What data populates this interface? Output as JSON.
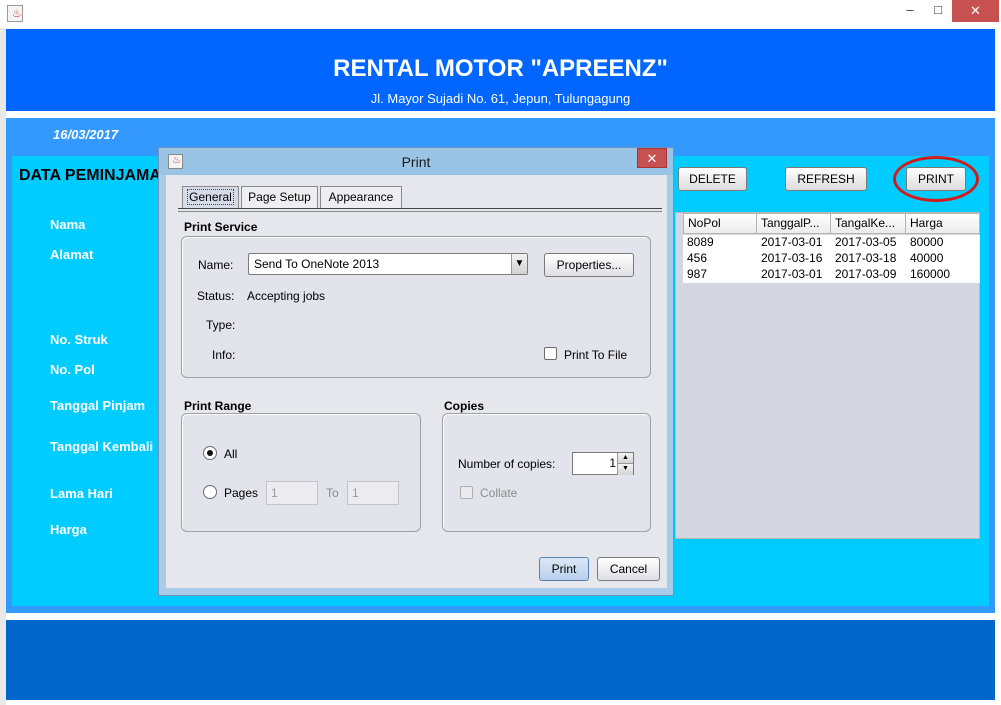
{
  "window": {
    "icon": "java-icon",
    "controls": {
      "minimize": "–",
      "maximize": "□",
      "close": "✕"
    }
  },
  "header": {
    "title": "RENTAL MOTOR \"APREENZ\"",
    "subtitle": "Jl. Mayor Sujadi No. 61, Jepun, Tulungagung"
  },
  "date": "16/03/2017",
  "section_title": "DATA PEMINJAMAN",
  "form_labels": {
    "nama": "Nama",
    "alamat": "Alamat",
    "no_struk": "No. Struk",
    "no_pol": "No. Pol",
    "tanggal_pinjam": "Tanggal Pinjam",
    "tanggal_kembali": "Tanggal Kembali",
    "lama_hari": "Lama Hari",
    "harga": "Harga"
  },
  "actions": {
    "delete": "DELETE",
    "refresh": "REFRESH",
    "print": "PRINT"
  },
  "table": {
    "columns": [
      "NoPol",
      "TanggalP...",
      "TangalKe...",
      "Harga"
    ],
    "rows": [
      [
        "8089",
        "2017-03-01",
        "2017-03-05",
        "80000"
      ],
      [
        "456",
        "2017-03-16",
        "2017-03-18",
        "40000"
      ],
      [
        "987",
        "2017-03-01",
        "2017-03-09",
        "160000"
      ]
    ]
  },
  "colors": {
    "header_blue": "#0066ff",
    "mid_blue": "#3399ff",
    "panel_cyan": "#00ccff",
    "footer_blue": "#0066cc",
    "highlight_red": "#d21b1b"
  },
  "dialog": {
    "title": "Print",
    "close_icon": "✕",
    "tabs": [
      "General",
      "Page Setup",
      "Appearance"
    ],
    "print_service": {
      "heading": "Print Service",
      "name_label": "Name:",
      "name_value": "Send To OneNote 2013",
      "properties_button": "Properties...",
      "status_label": "Status:",
      "status_value": "Accepting jobs",
      "type_label": "Type:",
      "info_label": "Info:",
      "print_to_file": "Print To File",
      "print_to_file_checked": false
    },
    "print_range": {
      "heading": "Print Range",
      "all_label": "All",
      "all_selected": true,
      "pages_label": "Pages",
      "pages_from": "1",
      "to_label": "To",
      "pages_to": "1"
    },
    "copies": {
      "heading": "Copies",
      "number_label": "Number of copies:",
      "number_value": "1",
      "collate_label": "Collate",
      "collate_checked": false
    },
    "buttons": {
      "print": "Print",
      "cancel": "Cancel"
    }
  }
}
